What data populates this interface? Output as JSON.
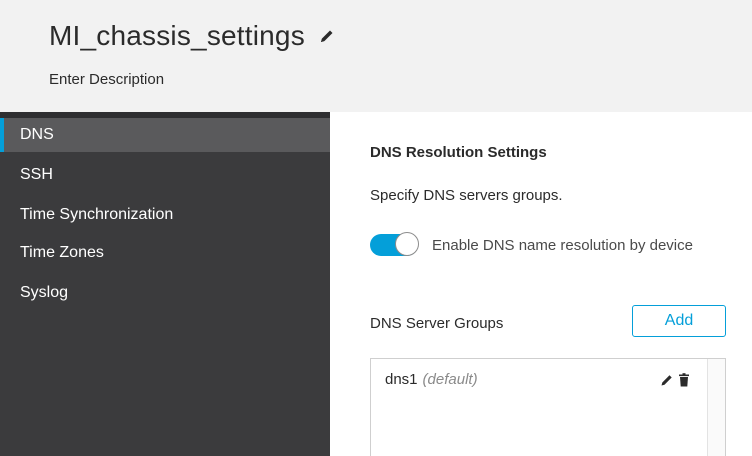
{
  "header": {
    "title": "MI_chassis_settings",
    "description": "Enter Description"
  },
  "sidebar": {
    "items": [
      {
        "label": "DNS",
        "active": true
      },
      {
        "label": "SSH",
        "active": false
      },
      {
        "label": "Time Synchronization",
        "active": false
      },
      {
        "label": "Time Zones",
        "active": false
      },
      {
        "label": "Syslog",
        "active": false
      }
    ]
  },
  "main": {
    "section_title": "DNS Resolution Settings",
    "section_description": "Specify DNS servers groups.",
    "toggle": {
      "label": "Enable DNS name resolution by device",
      "enabled": true
    },
    "server_groups": {
      "label": "DNS Server Groups",
      "add_label": "Add",
      "items": [
        {
          "name": "dns1",
          "tag": "(default)"
        }
      ]
    }
  },
  "colors": {
    "accent": "#049fd9",
    "sidebar_bg": "#3b3b3d",
    "sidebar_active_bg": "#5a5a5c",
    "header_bg": "#f2f2f2"
  },
  "icons": {
    "title_edit": "pencil-icon",
    "row_edit": "pencil-icon",
    "row_delete": "trash-icon"
  }
}
